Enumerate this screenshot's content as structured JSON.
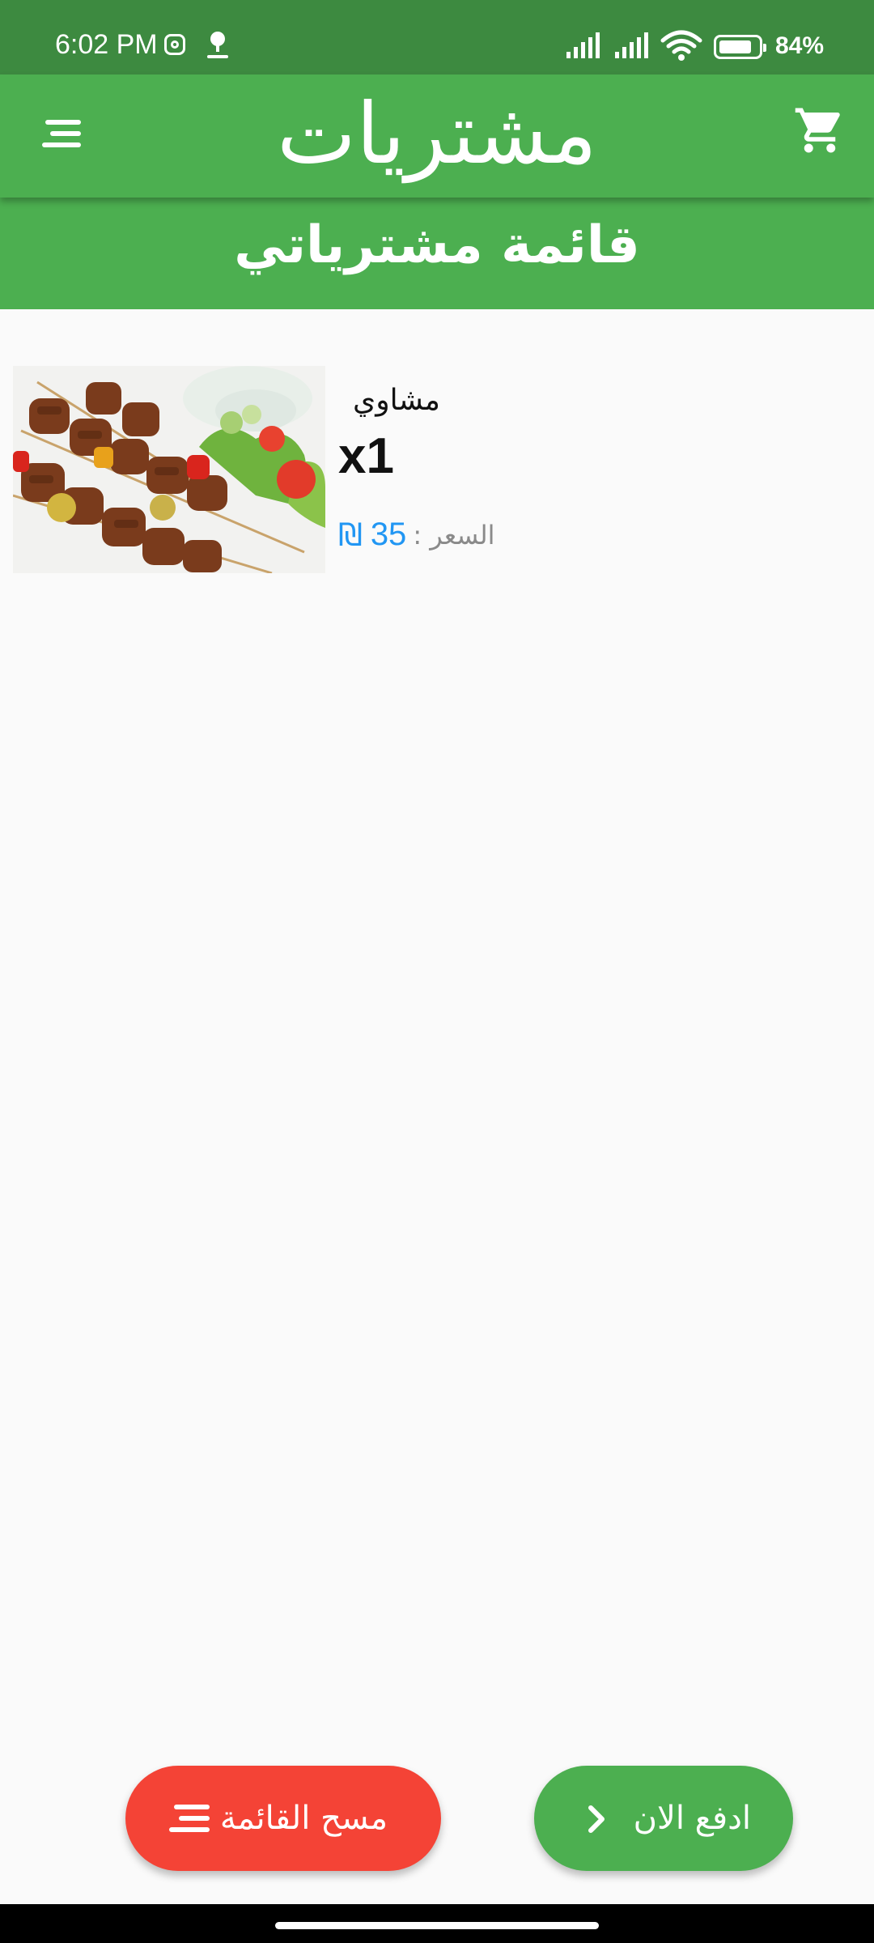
{
  "status_bar": {
    "time": "6:02 PM",
    "battery_percent": "84%",
    "battery_level": 0.84,
    "icons": [
      "instagram-icon",
      "tree-icon",
      "signal-icon",
      "signal-icon",
      "wifi-icon",
      "battery-icon"
    ]
  },
  "app_bar": {
    "title": "مشتريات",
    "menu_icon": "menu-icon",
    "cart_icon": "cart-icon",
    "color": "#4caf50"
  },
  "subheader": {
    "title": "قائمة مشترياتي"
  },
  "cart": {
    "items": [
      {
        "name": "مشاوي",
        "quantity": "x1",
        "price_label": "السعر :",
        "price_value": "35",
        "currency": "₪"
      }
    ]
  },
  "actions": {
    "clear_label": "مسح القائمة",
    "clear_icon": "sort-icon",
    "clear_color": "#f44336",
    "pay_label": "ادفع الان",
    "pay_icon": "chevron-right-icon",
    "pay_color": "#4caf50"
  }
}
